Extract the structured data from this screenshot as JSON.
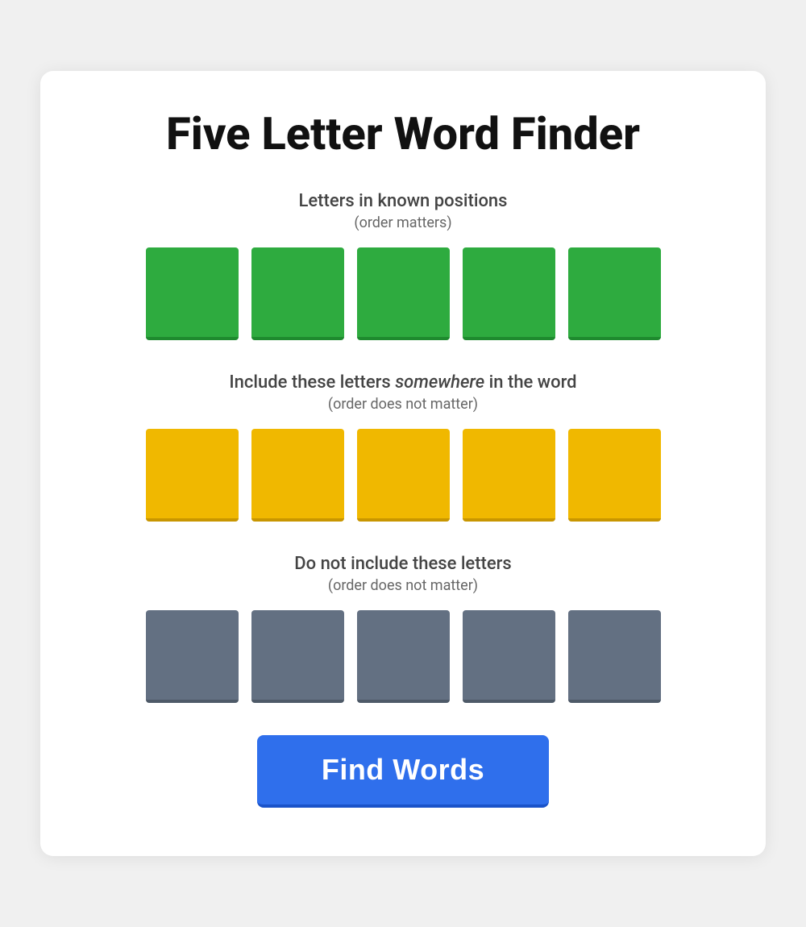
{
  "page": {
    "title": "Five Letter Word Finder",
    "card": {
      "section_known": {
        "label": "Letters in known positions",
        "sublabel": "(order matters)",
        "tiles": [
          {
            "id": 1,
            "value": ""
          },
          {
            "id": 2,
            "value": ""
          },
          {
            "id": 3,
            "value": ""
          },
          {
            "id": 4,
            "value": ""
          },
          {
            "id": 5,
            "value": ""
          }
        ]
      },
      "section_include": {
        "label_prefix": "Include these letters ",
        "label_italic": "somewhere",
        "label_suffix": " in the word",
        "sublabel": "(order does not matter)",
        "tiles": [
          {
            "id": 1,
            "value": ""
          },
          {
            "id": 2,
            "value": ""
          },
          {
            "id": 3,
            "value": ""
          },
          {
            "id": 4,
            "value": ""
          },
          {
            "id": 5,
            "value": ""
          }
        ]
      },
      "section_exclude": {
        "label": "Do not include these letters",
        "sublabel": "(order does not matter)",
        "tiles": [
          {
            "id": 1,
            "value": ""
          },
          {
            "id": 2,
            "value": ""
          },
          {
            "id": 3,
            "value": ""
          },
          {
            "id": 4,
            "value": ""
          },
          {
            "id": 5,
            "value": ""
          }
        ]
      },
      "button": {
        "label": "Find Words"
      }
    }
  }
}
